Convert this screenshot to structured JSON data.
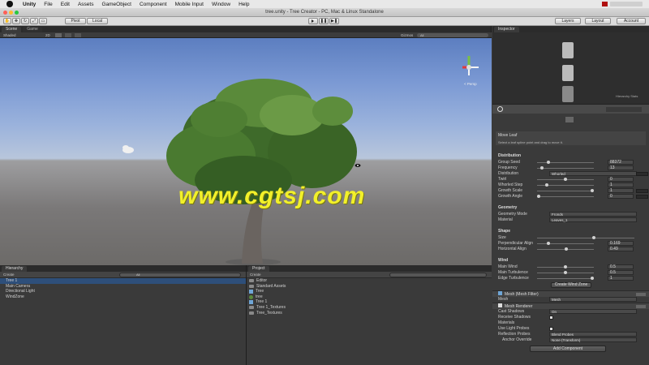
{
  "menubar": {
    "app": "Unity",
    "items": [
      "File",
      "Edit",
      "Assets",
      "GameObject",
      "Component",
      "Mobile Input",
      "Window",
      "Help"
    ]
  },
  "window": {
    "title": "tree.unity - Tree Creator - PC, Mac & Linux Standalone"
  },
  "toolbar": {
    "pivot": "Pivot",
    "local": "Local",
    "layers": "Layers",
    "layout": "Layout",
    "account": "Account"
  },
  "scene": {
    "tabs": [
      "Scene",
      "Game"
    ],
    "shading": "Shaded",
    "mode_2d": "2D",
    "gizmos": "Gizmos",
    "search_placeholder": "All",
    "persp": "< Persp",
    "watermark": "www.cgtsj.com"
  },
  "hierarchy": {
    "tab": "Hierarchy",
    "create": "Create",
    "search": "All",
    "items": [
      "Tree 1",
      "Main Camera",
      "Directional Light",
      "WindZone"
    ]
  },
  "project": {
    "tab": "Project",
    "create": "Create",
    "items": [
      {
        "label": "Editor",
        "icon": "folder"
      },
      {
        "label": "Standard Assets",
        "icon": "folder"
      },
      {
        "label": "Tree",
        "icon": "cube"
      },
      {
        "label": "tree",
        "icon": "tree"
      },
      {
        "label": "Tree 1",
        "icon": "cube"
      },
      {
        "label": "Tree 1_Textures",
        "icon": "folder"
      },
      {
        "label": "Tree_Textures",
        "icon": "folder"
      }
    ]
  },
  "inspector": {
    "tab": "Inspector",
    "hierarchy_stats": "Hierarchy Stats",
    "move_leaf": "Move Leaf",
    "move_leaf_hint": "Select a leaf spline point and drag to move it.",
    "distribution": {
      "title": "Distribution",
      "group_seed": {
        "label": "Group Seed",
        "value": "88372"
      },
      "frequency": {
        "label": "Frequency",
        "value": "13"
      },
      "distribution": {
        "label": "Distribution",
        "value": "Whorled"
      },
      "twirl": {
        "label": "Twirl",
        "value": "0"
      },
      "whorled_step": {
        "label": "Whorled Step",
        "value": "1"
      },
      "growth_scale": {
        "label": "Growth Scale",
        "value": "1"
      },
      "growth_angle": {
        "label": "Growth Angle",
        "value": "0"
      }
    },
    "geometry": {
      "title": "Geometry",
      "mode": {
        "label": "Geometry Mode",
        "value": "Fronds"
      },
      "material": {
        "label": "Material",
        "value": "Leaves_1"
      }
    },
    "shape": {
      "title": "Shape",
      "size": {
        "label": "Size"
      },
      "perpendicular": {
        "label": "Perpendicular Align",
        "value": "0.169"
      },
      "horizontal": {
        "label": "Horizontal Align",
        "value": "0.49"
      }
    },
    "wind": {
      "title": "Wind",
      "main": {
        "label": "Main Wind",
        "value": "0.5"
      },
      "turbulence": {
        "label": "Main Turbulence",
        "value": "0.5"
      },
      "edge": {
        "label": "Edge Turbulence",
        "value": "1"
      },
      "button": "Create Wind Zone"
    },
    "mesh_filter": {
      "title": "Mesh (Mesh Filter)",
      "mesh_label": "Mesh",
      "mesh_value": "Mesh"
    },
    "mesh_renderer": {
      "title": "Mesh Renderer",
      "cast_shadows": {
        "label": "Cast Shadows",
        "value": "On"
      },
      "receive_shadows": {
        "label": "Receive Shadows"
      },
      "materials": {
        "label": "Materials"
      },
      "light_probes": {
        "label": "Use Light Probes"
      },
      "reflection_probes": {
        "label": "Reflection Probes",
        "value": "Blend Probes"
      },
      "anchor": {
        "label": "Anchor Override",
        "value": "None (Transform)"
      }
    },
    "add_component": "Add Component"
  }
}
